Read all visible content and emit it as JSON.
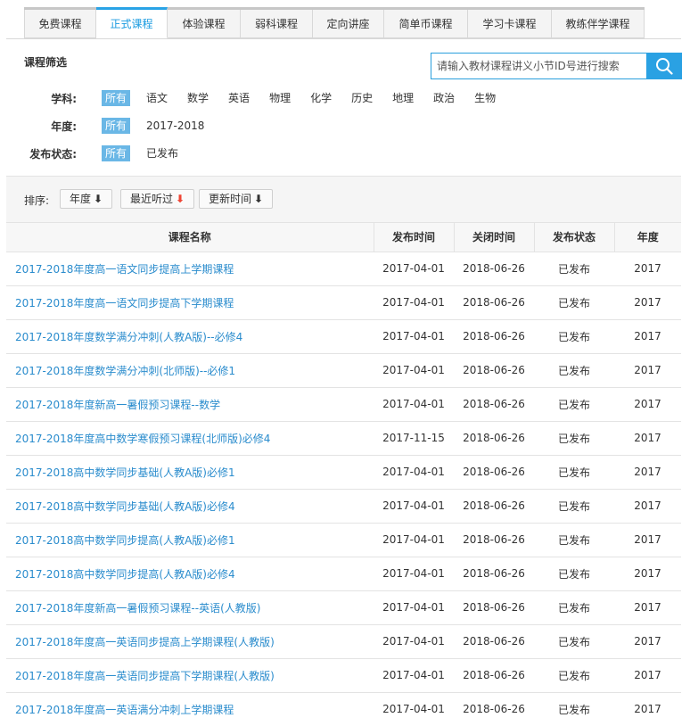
{
  "tabs": [
    "免费课程",
    "正式课程",
    "体验课程",
    "弱科课程",
    "定向讲座",
    "简单币课程",
    "学习卡课程",
    "教练伴学课程"
  ],
  "active_tab": "正式课程",
  "filter": {
    "title": "课程筛选",
    "search_placeholder": "请输入教材课程讲义小节ID号进行搜索",
    "subject_label": "学科:",
    "subjects": [
      "所有",
      "语文",
      "数学",
      "英语",
      "物理",
      "化学",
      "历史",
      "地理",
      "政治",
      "生物"
    ],
    "year_label": "年度:",
    "years": [
      "所有",
      "2017-2018"
    ],
    "status_label": "发布状态:",
    "statuses": [
      "所有",
      "已发布"
    ]
  },
  "sort": {
    "label": "排序:",
    "year_btn": "年度",
    "recent_btn": "最近听过",
    "update_btn": "更新时间",
    "arrow": "⬇"
  },
  "table": {
    "headers": [
      "课程名称",
      "发布时间",
      "关闭时间",
      "发布状态",
      "年度"
    ],
    "rows": [
      [
        "2017-2018年度高一语文同步提高上学期课程",
        "2017-04-01",
        "2018-06-26",
        "已发布",
        "2017"
      ],
      [
        "2017-2018年度高一语文同步提高下学期课程",
        "2017-04-01",
        "2018-06-26",
        "已发布",
        "2017"
      ],
      [
        "2017-2018年度数学满分冲刺(人教A版)--必修4",
        "2017-04-01",
        "2018-06-26",
        "已发布",
        "2017"
      ],
      [
        "2017-2018年度数学满分冲刺(北师版)--必修1",
        "2017-04-01",
        "2018-06-26",
        "已发布",
        "2017"
      ],
      [
        "2017-2018年度新高一暑假预习课程--数学",
        "2017-04-01",
        "2018-06-26",
        "已发布",
        "2017"
      ],
      [
        "2017-2018年度高中数学寒假预习课程(北师版)必修4",
        "2017-11-15",
        "2018-06-26",
        "已发布",
        "2017"
      ],
      [
        "2017-2018高中数学同步基础(人教A版)必修1",
        "2017-04-01",
        "2018-06-26",
        "已发布",
        "2017"
      ],
      [
        "2017-2018高中数学同步基础(人教A版)必修4",
        "2017-04-01",
        "2018-06-26",
        "已发布",
        "2017"
      ],
      [
        "2017-2018高中数学同步提高(人教A版)必修1",
        "2017-04-01",
        "2018-06-26",
        "已发布",
        "2017"
      ],
      [
        "2017-2018高中数学同步提高(人教A版)必修4",
        "2017-04-01",
        "2018-06-26",
        "已发布",
        "2017"
      ],
      [
        "2017-2018年度新高一暑假预习课程--英语(人教版)",
        "2017-04-01",
        "2018-06-26",
        "已发布",
        "2017"
      ],
      [
        "2017-2018年度高一英语同步提高上学期课程(人教版)",
        "2017-04-01",
        "2018-06-26",
        "已发布",
        "2017"
      ],
      [
        "2017-2018年度高一英语同步提高下学期课程(人教版)",
        "2017-04-01",
        "2018-06-26",
        "已发布",
        "2017"
      ],
      [
        "2017-2018年度高一英语满分冲刺上学期课程",
        "2017-04-01",
        "2018-06-26",
        "已发布",
        "2017"
      ]
    ]
  },
  "colors": {
    "accent": "#2aa1e3",
    "link": "#2a8ccd",
    "selected_chip": "#6ab7e6",
    "sort_down_red": "#e43"
  },
  "icons": {
    "search": "search-icon"
  }
}
